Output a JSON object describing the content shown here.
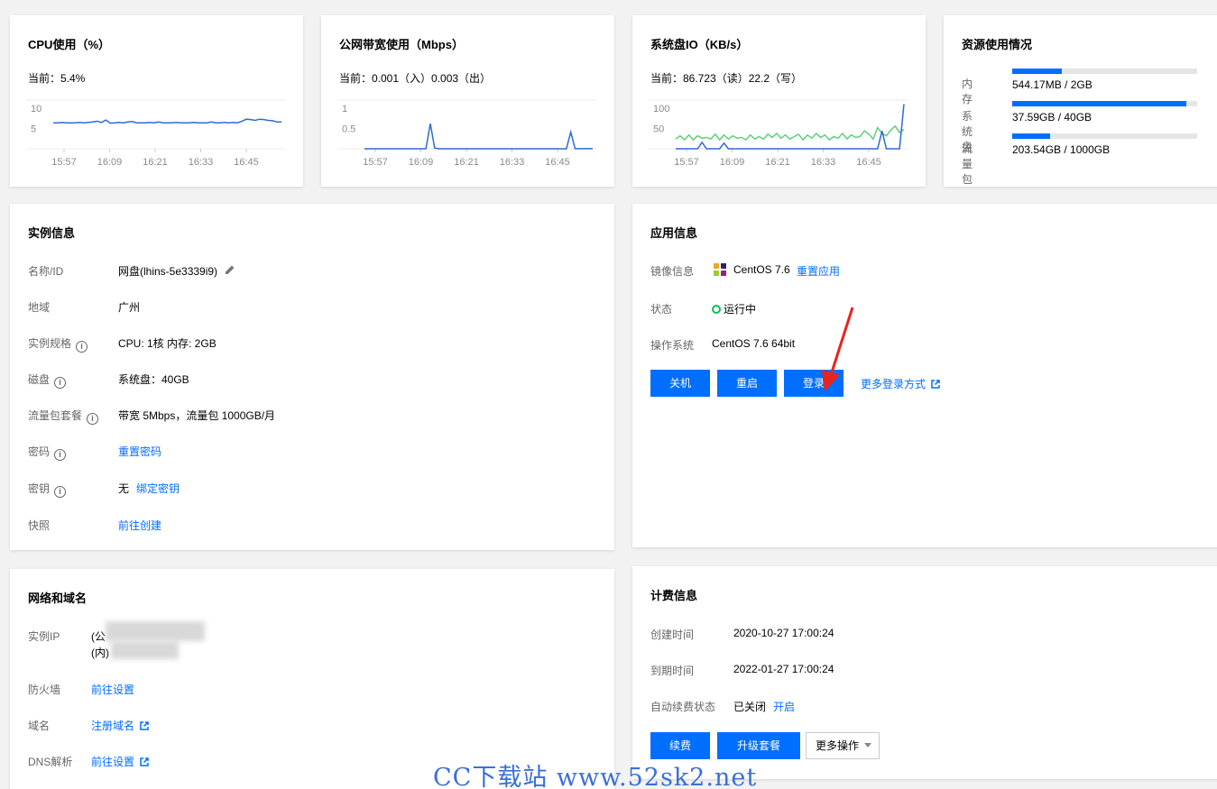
{
  "cpu": {
    "title": "CPU使用（%）",
    "current": "当前：5.4%",
    "chart_data": {
      "type": "line",
      "x_ticks": [
        "15:57",
        "16:09",
        "16:21",
        "16:33",
        "16:45"
      ],
      "y_ticks": [
        "10",
        "5"
      ],
      "ylim": [
        0,
        12
      ],
      "series": [
        {
          "values": [
            6.4,
            6.4,
            6.5,
            6.4,
            6.4,
            6.4,
            6.5,
            6.4,
            6.5,
            6.6,
            6.8,
            6.5,
            7.1,
            6.3,
            6.4,
            6.5,
            6.4,
            6.6,
            6.7,
            6.4,
            6.4,
            6.4,
            6.5,
            6.4,
            6.6,
            6.4,
            6.4,
            6.4,
            6.5,
            6.4,
            6.4,
            6.4,
            6.5,
            6.4,
            6.4,
            6.4,
            6.6,
            6.4,
            6.4,
            6.5,
            6.4,
            6.5,
            6.4,
            6.8,
            7.3,
            7.2,
            7.0,
            7.3,
            7.2,
            7.0,
            6.9,
            6.6,
            6.6
          ]
        }
      ]
    }
  },
  "bandwidth": {
    "title": "公网带宽使用（Mbps）",
    "current": "当前：0.001（入）0.003（出）",
    "chart_data": {
      "type": "line",
      "x_ticks": [
        "15:57",
        "16:09",
        "16:21",
        "16:33",
        "16:45"
      ],
      "y_ticks": [
        "1",
        "0.5"
      ],
      "ylim": [
        0,
        1.2
      ],
      "series": [
        {
          "values": [
            0.001,
            0.001,
            0.001,
            0.001,
            0.001,
            0.001,
            0.001,
            0.001,
            0.001,
            0.001,
            0.001,
            0.001,
            0.001,
            0.001,
            0.001,
            0.62,
            0.02,
            0.001,
            0.001,
            0.001,
            0.001,
            0.001,
            0.001,
            0.001,
            0.001,
            0.001,
            0.001,
            0.001,
            0.001,
            0.001,
            0.001,
            0.001,
            0.001,
            0.001,
            0.001,
            0.001,
            0.001,
            0.001,
            0.001,
            0.001,
            0.001,
            0.001,
            0.001,
            0.001,
            0.001,
            0.001,
            0.001,
            0.41,
            0.003,
            0.003,
            0.003,
            0.003,
            0.003
          ]
        }
      ]
    }
  },
  "disk_io": {
    "title": "系统盘IO（KB/s）",
    "current": "当前：86.723（读）22.2（写）",
    "chart_data": {
      "type": "line",
      "x_ticks": [
        "15:57",
        "16:09",
        "16:21",
        "16:33",
        "16:45"
      ],
      "y_ticks": [
        "100",
        "50"
      ],
      "ylim": [
        0,
        120
      ],
      "series": [
        {
          "color": "#5fd07a",
          "values": [
            24,
            32,
            22,
            34,
            22,
            32,
            26,
            28,
            24,
            36,
            22,
            34,
            24,
            32,
            26,
            28,
            22,
            34,
            24,
            30,
            24,
            36,
            28,
            38,
            26,
            34,
            24,
            30,
            36,
            22,
            34,
            26,
            38,
            28,
            34,
            22,
            30,
            26,
            38,
            24,
            34,
            28,
            30,
            44,
            36,
            24,
            52,
            38,
            32,
            46,
            56,
            40,
            48
          ]
        },
        {
          "color": "#2d6bd8",
          "values": [
            0,
            0,
            0,
            0,
            0,
            0,
            16,
            0,
            0,
            0,
            0,
            14,
            0,
            0,
            0,
            0,
            0,
            0,
            0,
            0,
            0,
            0,
            0,
            0,
            0,
            0,
            0,
            0,
            0,
            0,
            0,
            0,
            0,
            0,
            0,
            0,
            0,
            0,
            0,
            0,
            0,
            0,
            0,
            0,
            0,
            0,
            0,
            44,
            0,
            0,
            0,
            0,
            110
          ]
        }
      ]
    }
  },
  "resources": {
    "title": "资源使用情况",
    "items": [
      {
        "label": "内存",
        "value": "544.17MB / 2GB",
        "fraction": 0.266
      },
      {
        "label": "系统盘",
        "value": "37.59GB / 40GB",
        "fraction": 0.94
      },
      {
        "label": "流量包",
        "value": "203.54GB / 1000GB",
        "fraction": 0.204
      }
    ]
  },
  "instance": {
    "title": "实例信息",
    "name_label": "名称/ID",
    "name_value": "网盘(lhins-5e3339i9)",
    "region_label": "地域",
    "region_value": "广州",
    "spec_label": "实例规格",
    "spec_value": "CPU: 1核 内存: 2GB",
    "disk_label": "磁盘",
    "disk_value": "系统盘：40GB",
    "traffic_label": "流量包套餐",
    "traffic_value": "带宽 5Mbps，流量包 1000GB/月",
    "password_label": "密码",
    "password_link": "重置密码",
    "key_label": "密钥",
    "key_value": "无",
    "key_link": "绑定密钥",
    "snapshot_label": "快照",
    "snapshot_link": "前往创建"
  },
  "app": {
    "title": "应用信息",
    "image_label": "镜像信息",
    "image_value": "CentOS 7.6",
    "image_link": "重置应用",
    "status_label": "状态",
    "status_value": "运行中",
    "os_label": "操作系统",
    "os_value": "CentOS 7.6 64bit",
    "btn_shutdown": "关机",
    "btn_restart": "重启",
    "btn_login": "登录",
    "more_login": "更多登录方式"
  },
  "network": {
    "title": "网络和域名",
    "ip_label": "实例IP",
    "ip_public_prefix": "(公",
    "ip_private_prefix": "(内)",
    "firewall_label": "防火墙",
    "firewall_link": "前往设置",
    "domain_label": "域名",
    "domain_link": "注册域名",
    "dns_label": "DNS解析",
    "dns_link": "前往设置"
  },
  "billing": {
    "title": "计费信息",
    "created_label": "创建时间",
    "created_value": "2020-10-27 17:00:24",
    "expire_label": "到期时间",
    "expire_value": "2022-01-27 17:00:24",
    "renew_label": "自动续费状态",
    "renew_value": "已关闭",
    "renew_link": "开启",
    "btn_renew": "续费",
    "btn_upgrade": "升级套餐",
    "btn_more": "更多操作"
  },
  "watermark": "CC下载站 www.52sk2.net",
  "colors": {
    "accent": "#006eff",
    "status_ok": "#0abf5b",
    "line": "#2d6bd8",
    "line_green": "#5fd07a",
    "annotation": "#e8241c"
  }
}
